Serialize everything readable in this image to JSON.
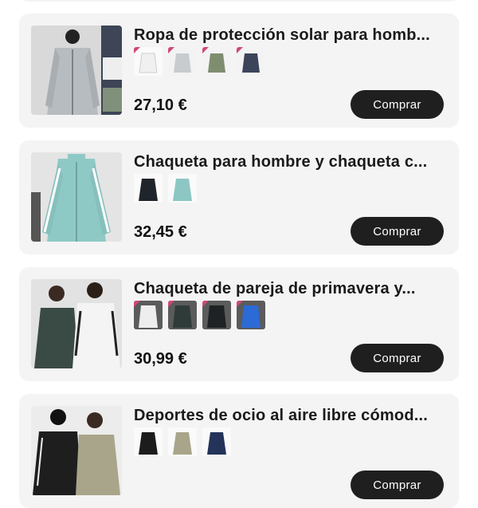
{
  "products": [
    {
      "title": "Ropa de protección solar para homb...",
      "price": "27,10 €",
      "buy_label": "Comprar",
      "image_color": "#b7bcc0",
      "variants": [
        "#f3f3f3",
        "#c8cccf",
        "#7f8d6f",
        "#3b4459"
      ]
    },
    {
      "title": "Chaqueta para hombre y chaqueta c...",
      "price": "32,45 €",
      "buy_label": "Comprar",
      "image_color": "#8fc9c6",
      "variants": [
        "#20252c",
        "#8cc7c4"
      ]
    },
    {
      "title": "Chaqueta de pareja de primavera y...",
      "price": "30,99 €",
      "buy_label": "Comprar",
      "image_color": "#3a4b46",
      "variants": [
        "#eeeeee",
        "#2f3b38",
        "#1e2224",
        "#2c6ad6"
      ]
    },
    {
      "title": "Deportes de ocio al aire libre cómod...",
      "price": "",
      "buy_label": "Comprar",
      "image_color": "#1e1e1e",
      "variants": [
        "#1c1c1c",
        "#a8a58a",
        "#23335a"
      ]
    }
  ]
}
